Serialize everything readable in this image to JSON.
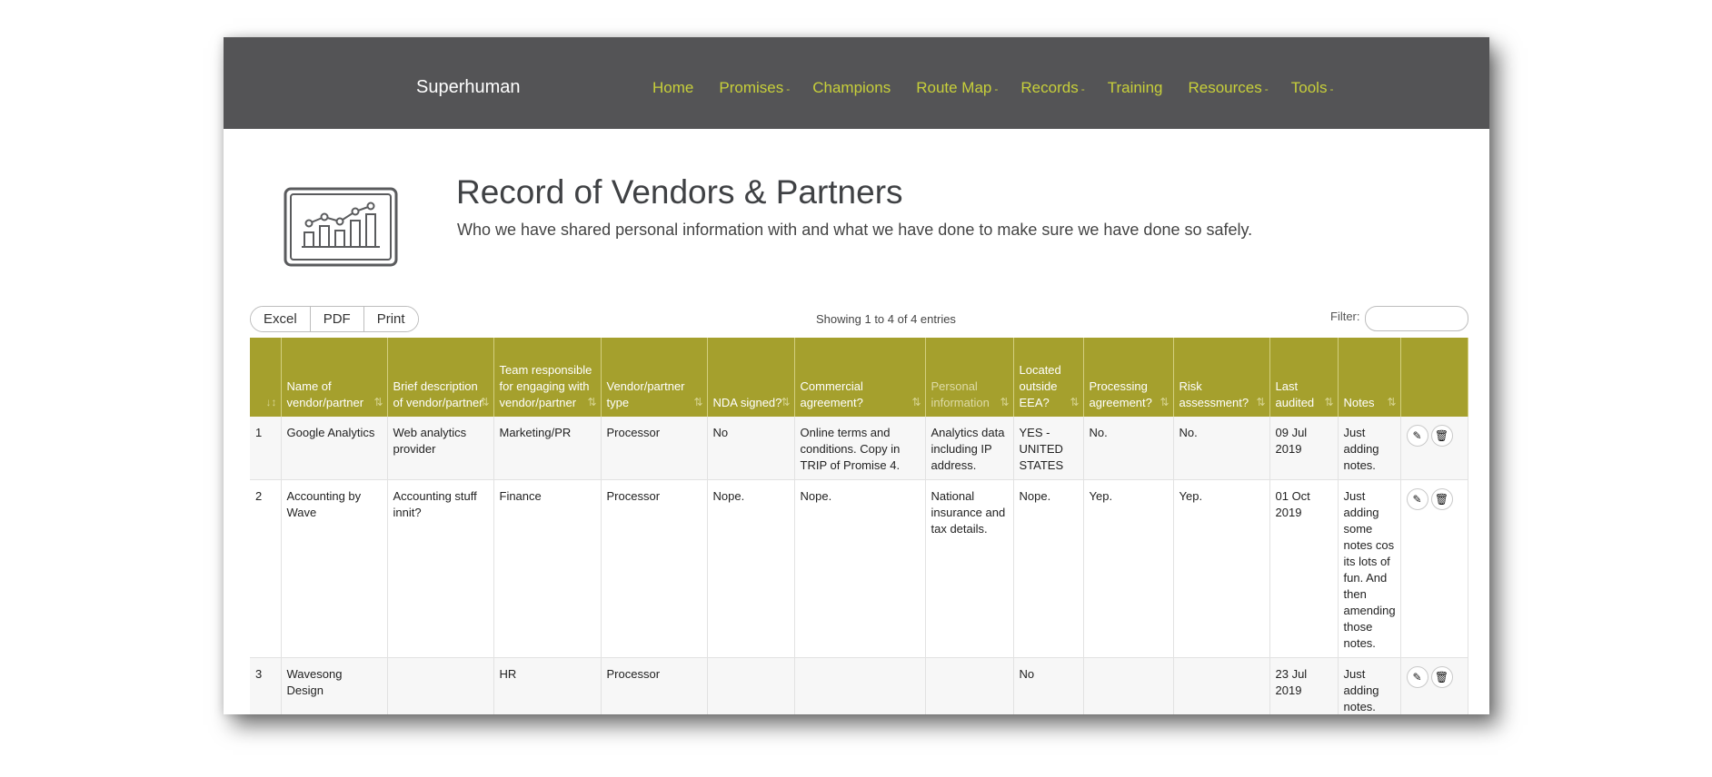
{
  "nav": {
    "brand": "Superhuman",
    "items": [
      {
        "label": "Home",
        "caret": ""
      },
      {
        "label": "Promises",
        "caret": "-"
      },
      {
        "label": "Champions",
        "caret": ""
      },
      {
        "label": "Route Map",
        "caret": "-"
      },
      {
        "label": "Records",
        "caret": "-"
      },
      {
        "label": "Training",
        "caret": ""
      },
      {
        "label": "Resources",
        "caret": "-"
      },
      {
        "label": "Tools",
        "caret": "-"
      }
    ]
  },
  "page": {
    "icon": "chart-monitor-icon",
    "title": "Record of Vendors & Partners",
    "subtitle": "Who we have shared personal information with and what we have done to make sure we have done so safely."
  },
  "toolbar": {
    "excel": "Excel",
    "pdf": "PDF",
    "print": "Print",
    "info": "Showing 1 to 4 of 4 entries",
    "filter_label": "Filter:"
  },
  "colors": {
    "nav_bg": "#545456",
    "nav_link": "#c7cf3a",
    "header_bg": "#a5a02d"
  },
  "table": {
    "headers": [
      "",
      "Name of vendor/partner",
      "Brief description of vendor/partner",
      "Team responsible for engaging with vendor/partner",
      "Vendor/partner type",
      "NDA signed?",
      "Commercial agreement?",
      "Personal information",
      "Located outside EEA?",
      "Processing agreement?",
      "Risk assessment?",
      "Last audited",
      "Notes",
      ""
    ],
    "rows": [
      [
        "1",
        "Google Analytics",
        "Web analytics provider",
        "Marketing/PR",
        "Processor",
        "No",
        "Online terms and conditions. Copy in TRIP of Promise 4.",
        "Analytics data including IP address.",
        "YES - UNITED STATES",
        "No.",
        "No.",
        "09 Jul 2019",
        "Just adding notes."
      ],
      [
        "2",
        "Accounting by Wave",
        "Accounting stuff innit?",
        "Finance",
        "Processor",
        "Nope.",
        "Nope.",
        "National insurance and tax details.",
        "Nope.",
        "Yep.",
        "Yep.",
        "01 Oct 2019",
        "Just adding some notes cos its lots of fun. And then amending those notes."
      ],
      [
        "3",
        "Wavesong Design",
        "",
        "HR",
        "Processor",
        "",
        "",
        "",
        "No",
        "",
        "",
        "23 Jul 2019",
        "Just adding notes."
      ]
    ],
    "edit_icon": "pencil-icon",
    "delete_icon": "trash-icon"
  }
}
